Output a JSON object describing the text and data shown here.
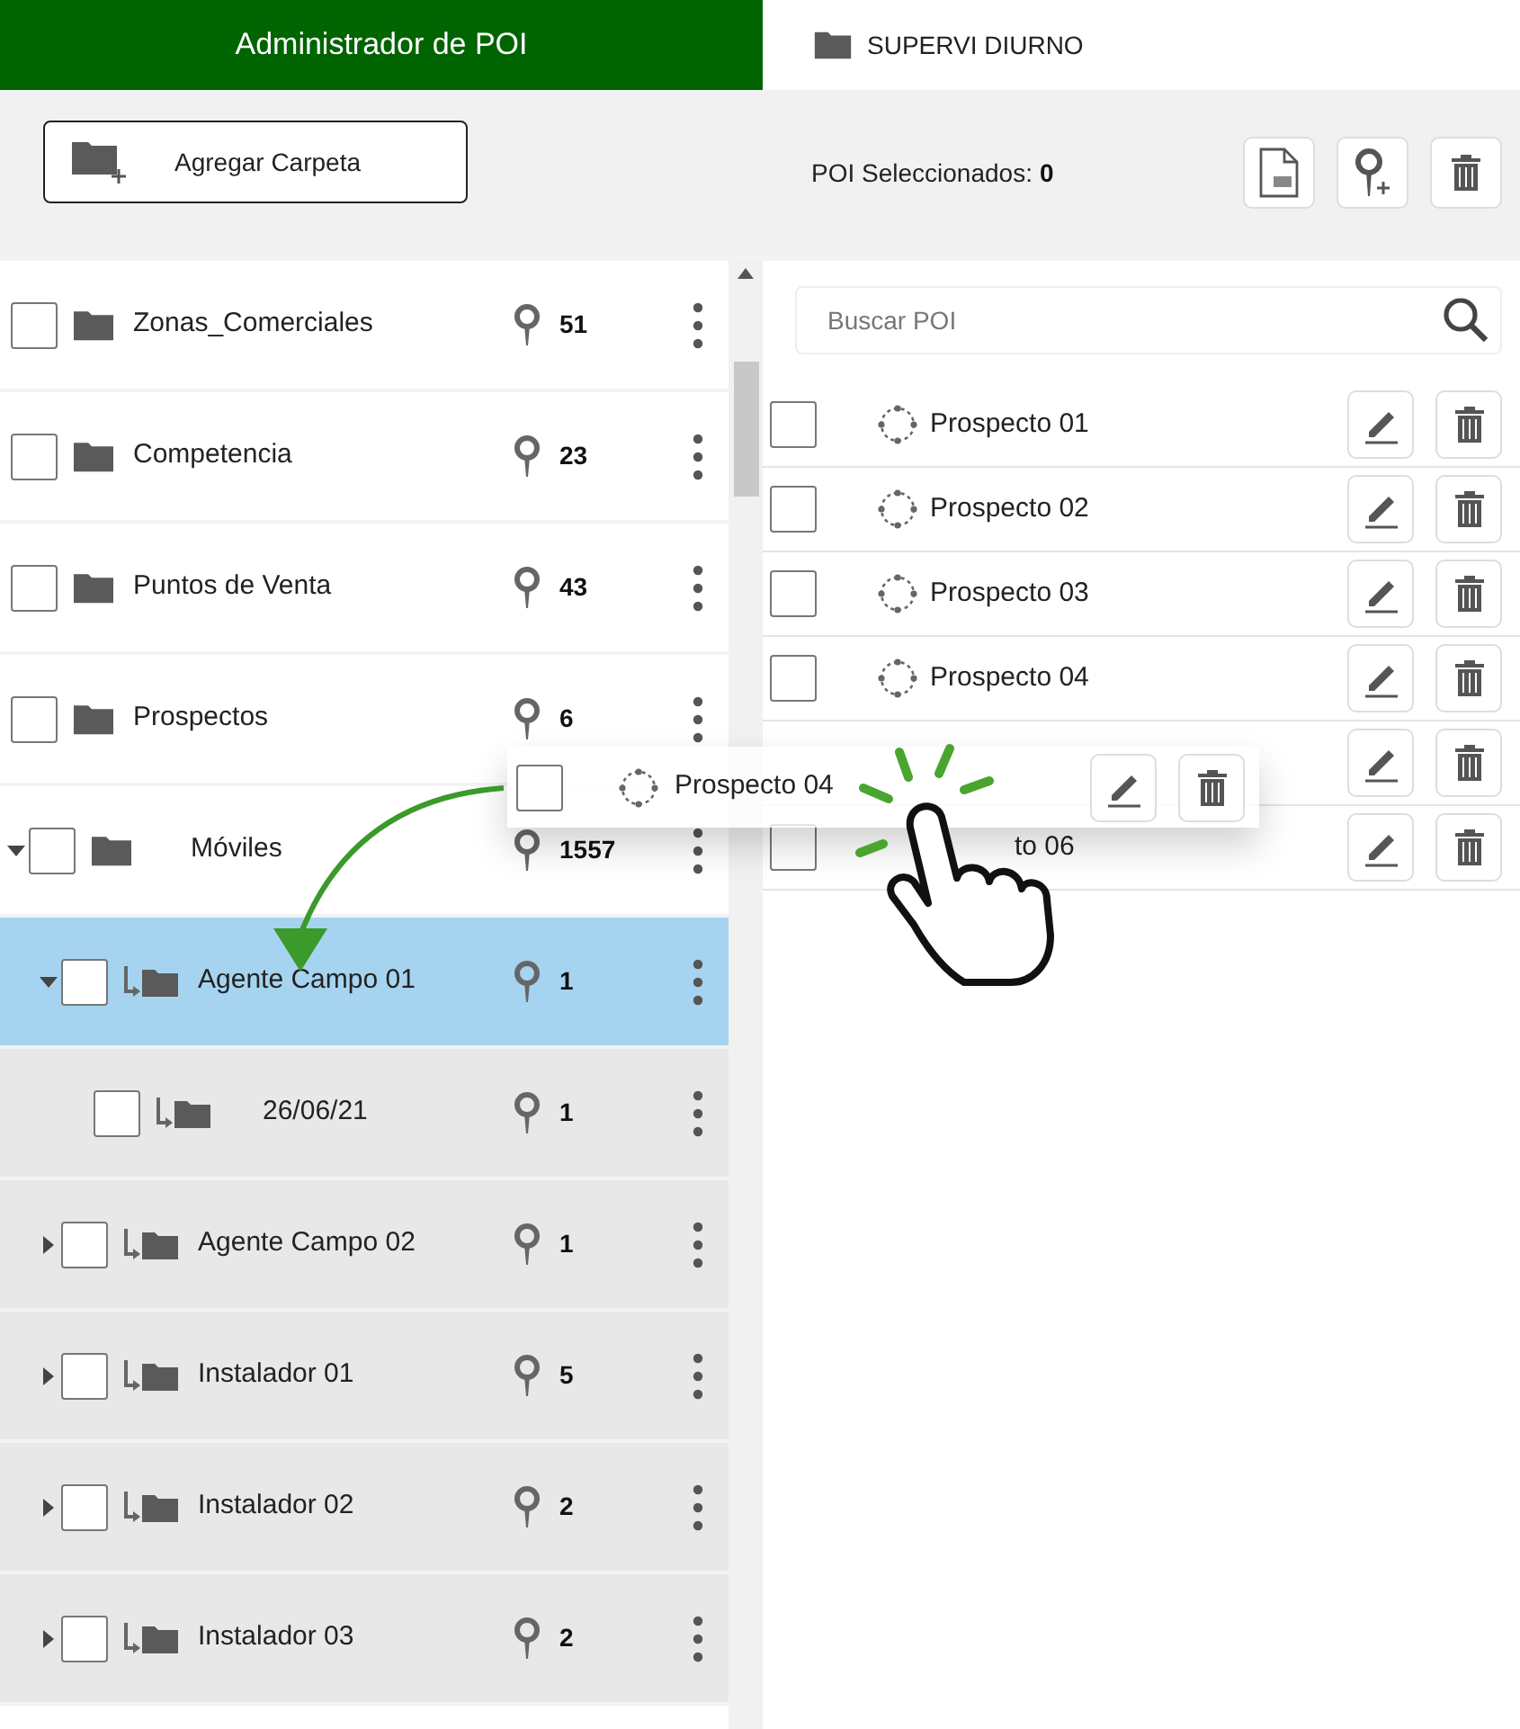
{
  "tabs": [
    {
      "label": "Administrador de POI",
      "selected": true,
      "kind": "plain"
    },
    {
      "label": "SUPERVI DIURNO",
      "selected": false,
      "kind": "folder"
    }
  ],
  "toolbar": {
    "add_folder_button": "Agregar Carpeta",
    "selected_label": "POI Seleccionados:",
    "selected_count": "0"
  },
  "tree": [
    {
      "name": "Zonas_Comerciales",
      "count": "51",
      "kind": "folder",
      "selected": false,
      "checked": false
    },
    {
      "name": "Competencia",
      "count": "23",
      "kind": "folder",
      "selected": false,
      "checked": false
    },
    {
      "name": "Puntos de Venta",
      "count": "43",
      "kind": "folder",
      "selected": false,
      "checked": false
    },
    {
      "name": "Prospectos",
      "count": "6",
      "kind": "folder",
      "selected": false,
      "checked": false
    },
    {
      "name": "Móviles",
      "count": "1557",
      "kind": "folder",
      "selected": false,
      "checked": false,
      "expanded": true,
      "children": [
        {
          "name": "Agente Campo 01",
          "count": "1",
          "kind": "mobile",
          "selected": true,
          "checked": false,
          "expanded": true,
          "children": [
            {
              "name": "26/06/21",
              "count": "1",
              "kind": "mobile",
              "selected": false,
              "checked": false
            }
          ]
        },
        {
          "name": "Agente Campo 02",
          "count": "1",
          "kind": "mobile",
          "selected": false,
          "checked": false,
          "expanded": false
        },
        {
          "name": "Instalador 01",
          "count": "5",
          "kind": "mobile",
          "selected": false,
          "checked": false,
          "expanded": false
        },
        {
          "name": "Instalador 02",
          "count": "2",
          "kind": "mobile",
          "selected": false,
          "checked": false,
          "expanded": false
        },
        {
          "name": "Instalador 03",
          "count": "2",
          "kind": "mobile",
          "selected": false,
          "checked": false,
          "expanded": false
        }
      ]
    }
  ],
  "search": {
    "placeholder": "Buscar POI"
  },
  "poi_list": [
    {
      "name": "Prospecto 01",
      "checked": false,
      "kind": "normal"
    },
    {
      "name": "Prospecto 02",
      "checked": false,
      "kind": "normal"
    },
    {
      "name": "Prospecto 03",
      "checked": false,
      "kind": "normal"
    },
    {
      "name": "Prospecto 04",
      "checked": false,
      "kind": "normal"
    },
    {
      "kind": "under_drag"
    },
    {
      "name": "to 06",
      "checked": false,
      "kind": "under_hand"
    }
  ],
  "drag_item": {
    "name": "Prospecto 04",
    "checked": false
  }
}
